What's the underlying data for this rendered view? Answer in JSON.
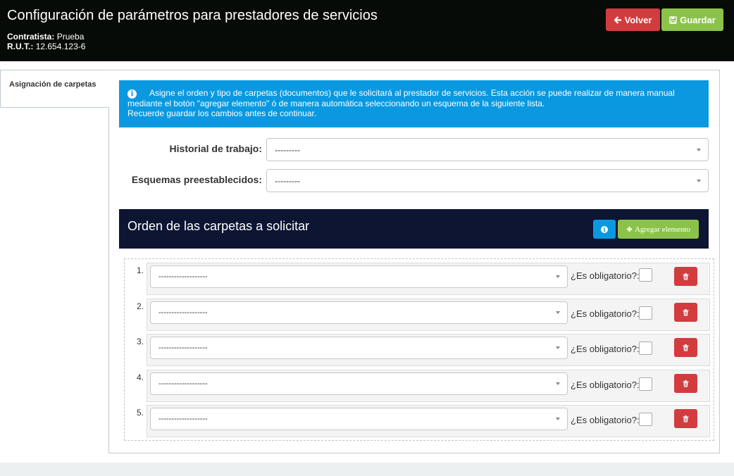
{
  "header": {
    "title": "Configuración de parámetros para prestadores de servicios",
    "contratista_label": "Contratista:",
    "contratista_value": "Prueba",
    "rut_label": "R.U.T.:",
    "rut_value": "12.654.123-6",
    "volver_label": "Volver",
    "guardar_label": "Guardar",
    "volver_icon": "arrow-left-icon",
    "guardar_icon": "floppy-disk-icon"
  },
  "sidebar": {
    "tab_label": "Asignación de carpetas"
  },
  "info": {
    "line1": "Asigne el orden y tipo de carpetas (documentos) que le solicitará al prestador de servicios. Esta acción se puede realizar de manera manual mediante el botón \"agregar elemento\" ó de manera automática seleccionando un esquema de la siguiente lista.",
    "line2": "Recuerde guardar los cambios antes de continuar."
  },
  "form": {
    "historial_label": "Historial de trabajo:",
    "historial_value": "---------",
    "esquemas_label": "Esquemas preestablecidos:",
    "esquemas_value": "---------"
  },
  "orden": {
    "title": "Orden de las carpetas a solicitar",
    "agregar_label": "Agregar elemento"
  },
  "items": [
    {
      "num": "1.",
      "value": "-------------------",
      "oblig_label": "¿Es obligatorio?:",
      "checked": false
    },
    {
      "num": "2.",
      "value": "-------------------",
      "oblig_label": "¿Es obligatorio?:",
      "checked": false
    },
    {
      "num": "3.",
      "value": "-------------------",
      "oblig_label": "¿Es obligatorio?:",
      "checked": false
    },
    {
      "num": "4.",
      "value": "-------------------",
      "oblig_label": "¿Es obligatorio?:",
      "checked": false
    },
    {
      "num": "5.",
      "value": "-------------------",
      "oblig_label": "¿Es obligatorio?:",
      "checked": false
    }
  ],
  "colors": {
    "header_bg": "#070b07",
    "danger": "#d23c3f",
    "success": "#8bc34a",
    "info": "#0a99e0",
    "navy": "#0d1533"
  }
}
